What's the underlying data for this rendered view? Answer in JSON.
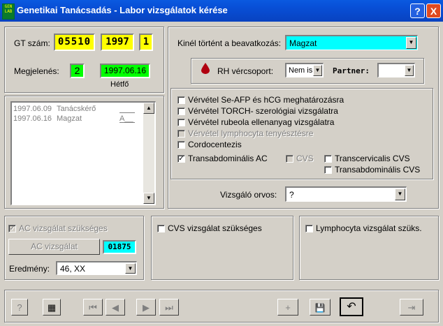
{
  "window": {
    "title": "Genetikai Tanácsadás - Labor vizsgálatok kérése",
    "icon_text": "GEN LAB",
    "help_label": "?",
    "close_label": "X"
  },
  "gt": {
    "label": "GT szám:",
    "number": "05510",
    "year": "1997",
    "seq": "1"
  },
  "megjelenes": {
    "label": "Megjelenés:",
    "count": "2",
    "date": "1997.06.16",
    "weekday": "Hétfő"
  },
  "history": [
    {
      "date": "1997.06.09",
      "who": "Tanácskérő",
      "code": ""
    },
    {
      "date": "1997.06.16",
      "who": "Magzat",
      "code": "A__"
    }
  ],
  "kinel": {
    "label": "Kinél történt a beavatkozás:",
    "value": "Magzat"
  },
  "rh": {
    "label": "RH vércsoport:",
    "value": "Nem is",
    "partner_label": "Partner:",
    "partner_value": ""
  },
  "checks": {
    "afp": "Vérvétel Se-AFP és hCG meghatározásra",
    "torch": "Vérvétel TORCH- szerológiai vizsgálatra",
    "rubeola": "Vérvétel rubeola ellenanyag vizsgálatra",
    "lympho": "Vérvétel lymphocyta tenyésztésre",
    "cordo": "Cordocentezis",
    "transab": "Transabdominális AC",
    "transab_check": "✓",
    "cvs": "CVS",
    "transcerv": "Transcervicalis CVS",
    "transab_cvs": "Transabdominális CVS"
  },
  "orvos": {
    "label": "Vizsgáló orvos:",
    "value": "?"
  },
  "ac": {
    "needed_label": "AC vizsgálat szükséges",
    "needed_check": "✓",
    "button_label": "AC vizsgálat",
    "code": "01875",
    "result_label": "Eredmény:",
    "result_value": "46, XX"
  },
  "cvs_needed": "CVS vizsgálat szükséges",
  "lympho_needed": "Lymphocyta vizsgálat szüks.",
  "toolbar": {
    "help": "?",
    "calc": "▦",
    "first": "⏮",
    "prev": "◀",
    "next": "▶",
    "last": "⏭",
    "new": "+",
    "save": "💾",
    "undo": "↶",
    "exit": "⇥"
  },
  "colors": {
    "title_blue": "#0842c0",
    "yellow": "#ffff00",
    "green": "#00ff00",
    "cyan": "#00ffff",
    "face": "#d4d0c8"
  }
}
